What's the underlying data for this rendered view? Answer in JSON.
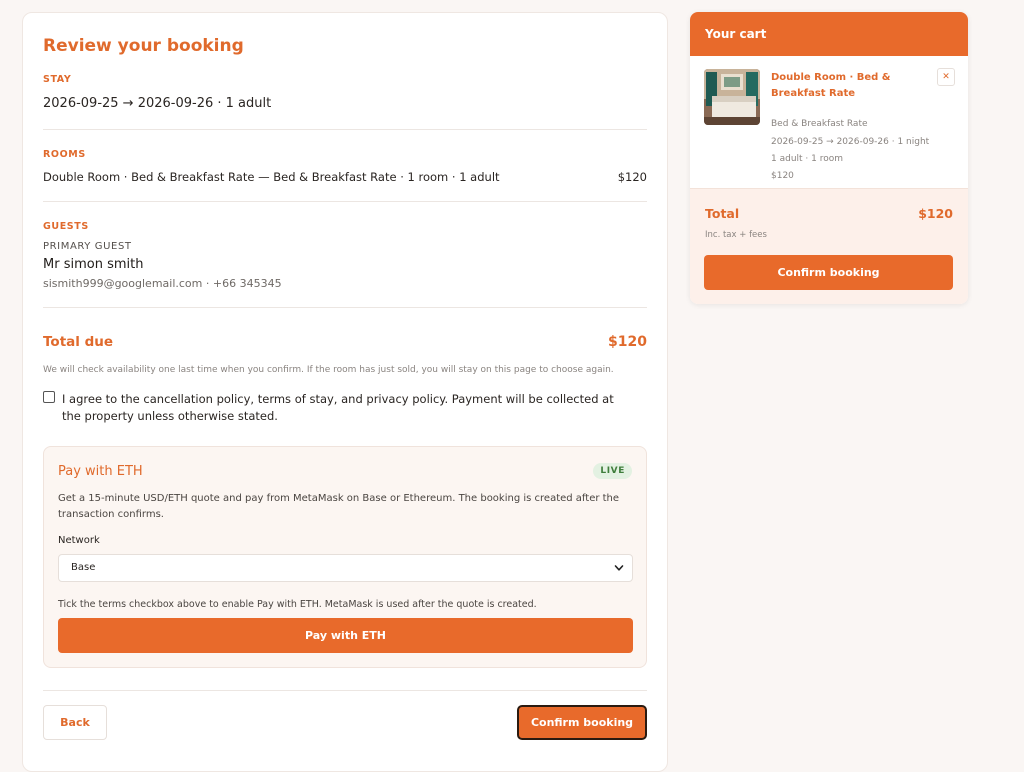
{
  "review": {
    "title": "Review your booking",
    "stay": {
      "label": "STAY",
      "dates": "2026-09-25 → 2026-09-26 · 1 adult"
    },
    "rooms": {
      "label": "ROOMS",
      "description": "Double Room · Bed & Breakfast Rate — Bed & Breakfast Rate · 1 room · 1 adult",
      "price": "$120"
    },
    "guests": {
      "label": "GUESTS",
      "primary_label": "PRIMARY GUEST",
      "name": "Mr simon smith",
      "contact": "sismith999@googlemail.com · +66 345345"
    },
    "total": {
      "label": "Total due",
      "value": "$120"
    },
    "availability_note": "We will check availability one last time when you confirm. If the room has just sold, you will stay on this page to choose again.",
    "terms": {
      "checked": false,
      "text": "I agree to the cancellation policy, terms of stay, and privacy policy. Payment will be collected at the property unless otherwise stated."
    }
  },
  "eth_payment": {
    "title": "Pay with ETH",
    "badge": "LIVE",
    "description": "Get a 15-minute USD/ETH quote and pay from MetaMask on Base or Ethereum. The booking is created after the transaction confirms.",
    "network_label": "Network",
    "network_selected": "Base",
    "hint": "Tick the terms checkbox above to enable Pay with ETH. MetaMask is used after the quote is created.",
    "button_label": "Pay with ETH"
  },
  "actions": {
    "back_label": "Back",
    "confirm_label": "Confirm booking"
  },
  "cart": {
    "title": "Your cart",
    "item": {
      "name": "Double Room · Bed & Breakfast Rate",
      "rate": "Bed & Breakfast Rate",
      "dates": "2026-09-25 → 2026-09-26 · 1 night",
      "occupancy": "1 adult · 1 room",
      "price": "$120",
      "remove_symbol": "✕"
    },
    "total_label": "Total",
    "total_value": "$120",
    "tax_note": "Inc. tax + fees",
    "confirm_label": "Confirm booking"
  },
  "colors": {
    "accent": "#e86a2b",
    "accent_text": "#e06a2c",
    "page_bg": "#faf6f4",
    "live_badge_bg": "#e3f1e2",
    "live_badge_text": "#3f7d3b"
  },
  "icons": {
    "select_arrow": "chevron-down-icon",
    "remove": "close-icon",
    "thumbnail": "room-photo"
  }
}
